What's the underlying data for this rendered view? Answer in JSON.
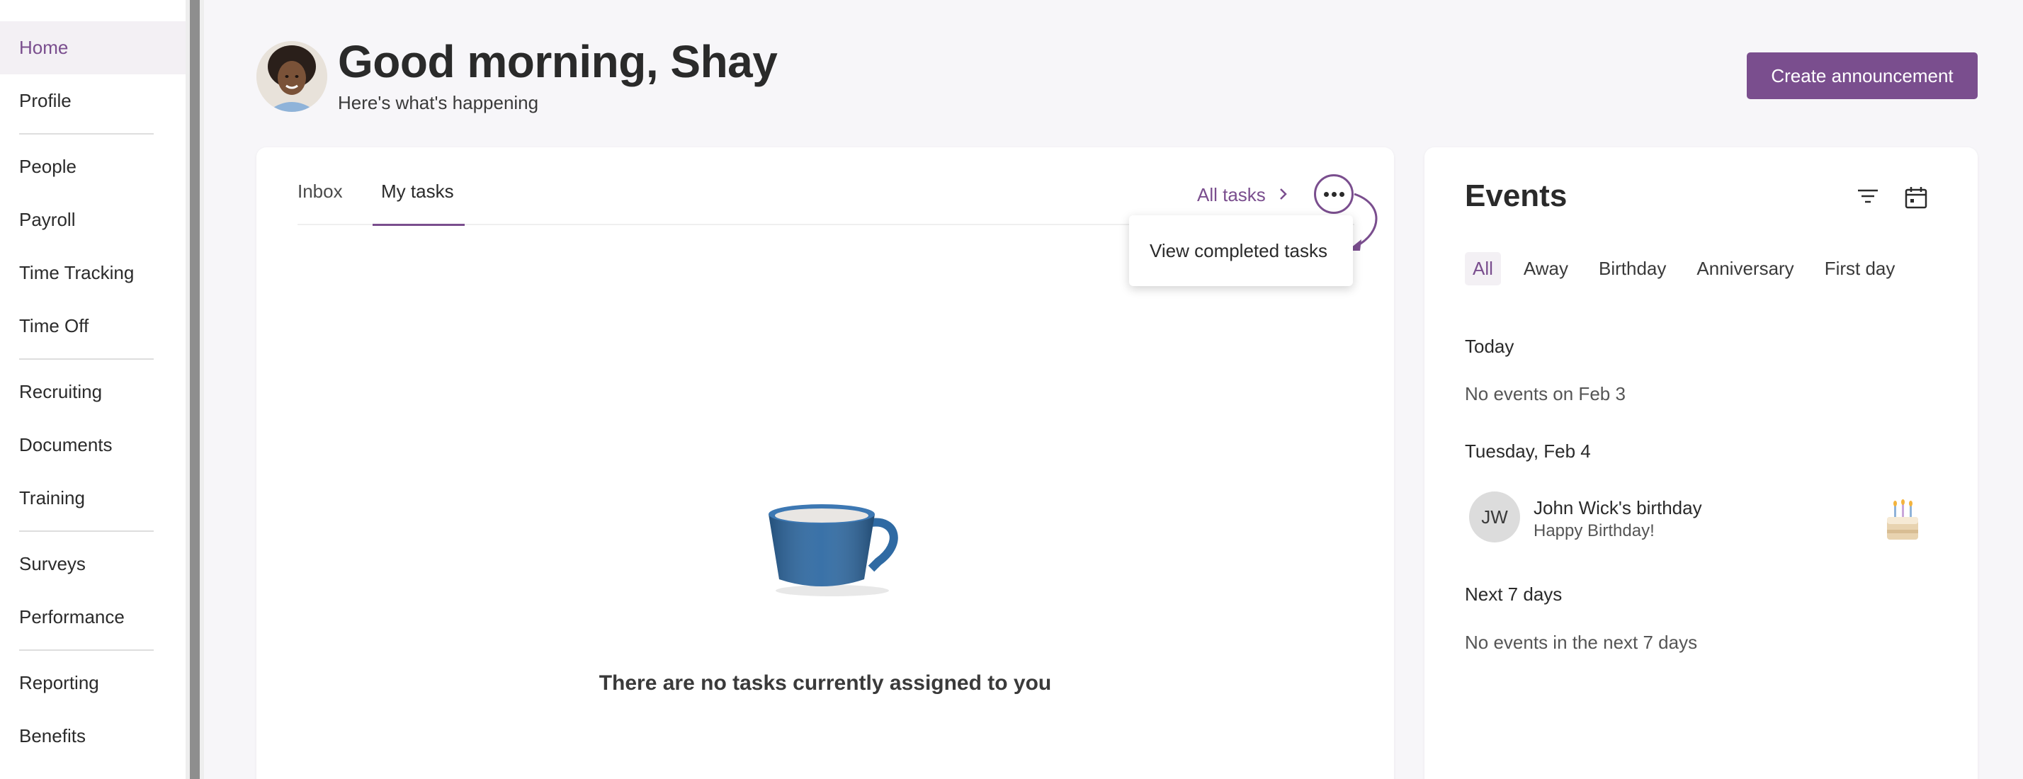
{
  "sidebar": {
    "items": [
      {
        "label": "Home",
        "active": true
      },
      {
        "label": "Profile"
      },
      {
        "label": "People"
      },
      {
        "label": "Payroll"
      },
      {
        "label": "Time Tracking"
      },
      {
        "label": "Time Off"
      },
      {
        "label": "Recruiting"
      },
      {
        "label": "Documents"
      },
      {
        "label": "Training"
      },
      {
        "label": "Surveys"
      },
      {
        "label": "Performance"
      },
      {
        "label": "Reporting"
      },
      {
        "label": "Benefits"
      }
    ]
  },
  "header": {
    "greeting": "Good morning, Shay",
    "subtitle": "Here's what's happening",
    "create_button": "Create announcement"
  },
  "tasks": {
    "tabs": [
      "Inbox",
      "My tasks"
    ],
    "active_tab": "My tasks",
    "all_tasks_link": "All tasks",
    "menu": {
      "view_completed": "View completed tasks"
    },
    "empty_message": "There are no tasks currently assigned to you"
  },
  "events": {
    "title": "Events",
    "chips": [
      "All",
      "Away",
      "Birthday",
      "Anniversary",
      "First day"
    ],
    "active_chip": "All",
    "today": {
      "heading": "Today",
      "empty": "No events on Feb 3"
    },
    "tuesday": {
      "heading": "Tuesday, Feb 4",
      "event": {
        "initials": "JW",
        "name": "John Wick's birthday",
        "description": "Happy Birthday!"
      }
    },
    "next7": {
      "heading": "Next 7 days",
      "empty": "No events in the next 7 days"
    }
  },
  "colors": {
    "accent": "#7a4e8e",
    "background": "#f7f6f9",
    "active_nav_bg": "#f3f0f4"
  }
}
